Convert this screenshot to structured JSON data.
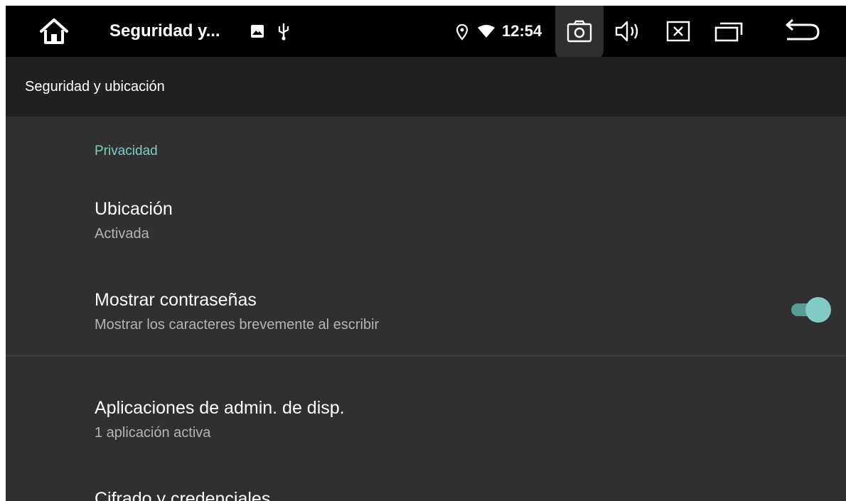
{
  "statusbar": {
    "app_title": "Seguridad y...",
    "time": "12:54",
    "icons": [
      "home-icon",
      "image-icon",
      "usb-icon",
      "location-icon",
      "wifi-icon",
      "screenshot-icon",
      "volume-icon",
      "close-app-icon",
      "recents-icon",
      "back-icon"
    ]
  },
  "toolbar": {
    "title": "Seguridad y ubicación"
  },
  "content": {
    "section_privacy": "Privacidad",
    "location": {
      "title": "Ubicación",
      "summary": "Activada"
    },
    "show_passwords": {
      "title": "Mostrar contraseñas",
      "summary": "Mostrar los caracteres brevemente al escribir",
      "enabled": true
    },
    "device_admin": {
      "title": "Aplicaciones de admin. de disp.",
      "summary": "1 aplicación activa"
    },
    "encryption": {
      "title": "Cifrado y credenciales"
    }
  },
  "colors": {
    "accent": "#80cbc4",
    "background": "#303030",
    "toolbar": "#212121",
    "statusbar": "#000000"
  }
}
